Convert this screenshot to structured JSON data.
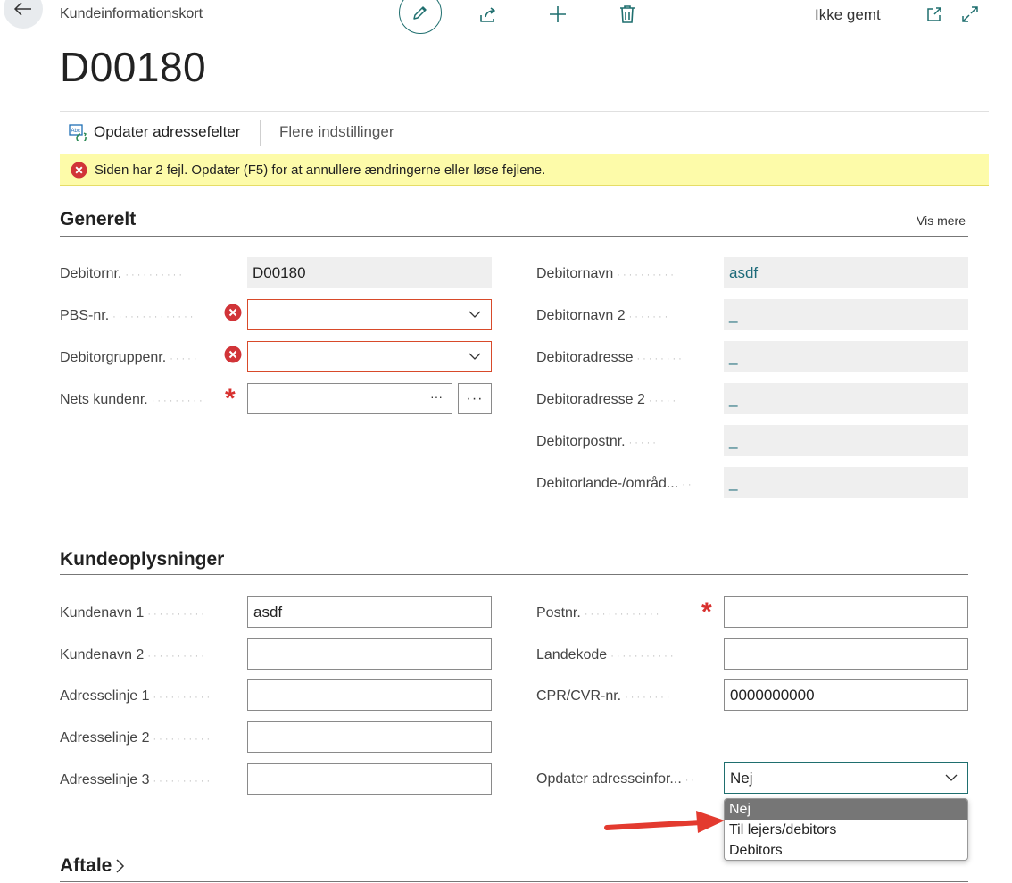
{
  "header": {
    "breadcrumb": "Kundeinformationskort",
    "save_status": "Ikke gemt",
    "record_title": "D00180",
    "icons": [
      "back-arrow-icon",
      "pencil-icon",
      "share-icon",
      "plus-icon",
      "trash-icon",
      "open-new-window-icon",
      "expand-icon"
    ]
  },
  "actions": {
    "update_address": "Opdater adressefelter",
    "more_settings": "Flere indstillinger"
  },
  "error_banner": {
    "message": "Siden har 2 fejl. Opdater (F5) for at annullere ændringerne eller løse fejlene."
  },
  "general": {
    "title": "Generelt",
    "show_more": "Vis mere",
    "left": [
      {
        "label": "Debitornr.",
        "value": "D00180"
      },
      {
        "label": "PBS-nr.",
        "value": ""
      },
      {
        "label": "Debitorgruppenr.",
        "value": ""
      },
      {
        "label": "Nets kundenr.",
        "value": "",
        "ellipsis": "···"
      }
    ],
    "right": [
      {
        "label": "Debitornavn",
        "value": "asdf"
      },
      {
        "label": "Debitornavn 2",
        "value": "_"
      },
      {
        "label": "Debitoradresse",
        "value": "_"
      },
      {
        "label": "Debitoradresse 2",
        "value": "_"
      },
      {
        "label": "Debitorpostnr.",
        "value": "_"
      },
      {
        "label": "Debitorlande-/områd...",
        "value": "_"
      }
    ]
  },
  "customer_info": {
    "title": "Kundeoplysninger",
    "left": [
      {
        "label": "Kundenavn 1",
        "value": "asdf"
      },
      {
        "label": "Kundenavn 2",
        "value": ""
      },
      {
        "label": "Adresselinje 1",
        "value": ""
      },
      {
        "label": "Adresselinje 2",
        "value": ""
      },
      {
        "label": "Adresselinje 3",
        "value": ""
      }
    ],
    "right": [
      {
        "label": "Postnr.",
        "value": ""
      },
      {
        "label": "Landekode",
        "value": ""
      },
      {
        "label": "CPR/CVR-nr.",
        "value": "0000000000"
      },
      {
        "label": "Opdater adresseinfor...",
        "value": "Nej"
      }
    ],
    "dropdown_options": [
      "Nej",
      "Til lejers/debitors",
      "Debitors"
    ]
  },
  "agreement": {
    "title": "Aftale"
  },
  "colors": {
    "accent": "#1f6f6f",
    "error": "#d84a2a",
    "banner": "#fdfba9",
    "link": "#1e6b7a"
  }
}
